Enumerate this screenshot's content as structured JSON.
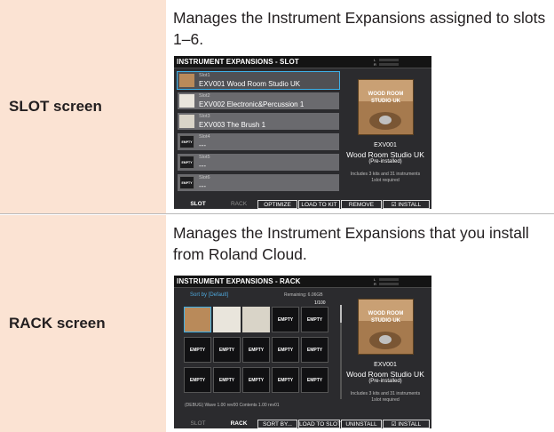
{
  "slot_row": {
    "label": "SLOT screen",
    "description": "Manages the Instrument Expansions assigned to slots 1–6.",
    "screen": {
      "title": "INSTRUMENT EXPANSIONS - SLOT",
      "level_l": "L",
      "level_r": "R",
      "slots": [
        {
          "num": "Slot1",
          "name": "EXV001  Wood Room Studio UK",
          "thumb": ""
        },
        {
          "num": "Slot2",
          "name": "EXV002 Electronic&Percussion 1",
          "thumb": ""
        },
        {
          "num": "Slot3",
          "name": "EXV003 The Brush 1",
          "thumb": ""
        },
        {
          "num": "Slot4",
          "name": "---",
          "thumb": "EMPTY"
        },
        {
          "num": "Slot5",
          "name": "---",
          "thumb": "EMPTY"
        },
        {
          "num": "Slot6",
          "name": "---",
          "thumb": "EMPTY"
        }
      ],
      "info": {
        "cover_line1": "WOOD ROOM",
        "cover_line2": "STUDIO UK",
        "id": "EXV001",
        "name": "Wood Room Studio UK",
        "status": "(Pre-installed)",
        "includes": "Includes 3 kits and 31 instruments",
        "required": "1slot required"
      },
      "buttons": {
        "tab1": "SLOT",
        "tab2": "RACK",
        "b1": "OPTIMIZE",
        "b2": "LOAD TO KIT",
        "b3": "REMOVE",
        "b4": "☑ INSTALL"
      }
    }
  },
  "rack_row": {
    "label": "RACK screen",
    "description": "Manages the Instrument Expansions that you install from Roland Cloud.",
    "screen": {
      "title": "INSTRUMENT EXPANSIONS - RACK",
      "level_l": "L",
      "level_r": "R",
      "sort": "Sort by [Default]",
      "remaining": "Remaining: 6.06GB",
      "page": "1/100",
      "empty_label": "EMPTY",
      "debug": "(DEBUG) Wave 1.00 rev00 Contents 1.00 rev01",
      "info": {
        "cover_line1": "WOOD ROOM",
        "cover_line2": "STUDIO UK",
        "id": "EXV001",
        "name": "Wood Room Studio UK",
        "status": "(Pre-installed)",
        "includes": "Includes 3 kits and 31 instruments",
        "required": "1slot required"
      },
      "buttons": {
        "tab1": "SLOT",
        "tab2": "RACK",
        "b1": "SORT BY...",
        "b2": "LOAD TO SLOT",
        "b3": "UNINSTALL",
        "b4": "☑ INSTALL"
      }
    }
  }
}
